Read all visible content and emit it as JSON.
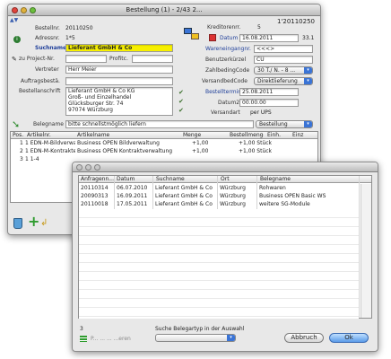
{
  "main": {
    "title": "Bestellung (1) - 2/43 2...",
    "order_id_right": "1'20110250",
    "bestellnr_label": "Bestellnr.",
    "bestellnr_value": "20110250",
    "adressnr_label": "Adressnr.",
    "adressnr_value": "1*5",
    "suchname_label": "Suchname",
    "suchname_value": "Lieferant GmbH & Co",
    "projekt_label": "zu Project-Nr.",
    "projekt_suffix": "Profitc.",
    "vertreter_label": "Vertreter",
    "vertreter_value": "Herr Meier",
    "auftragsbestae_label": "Auftragsbestä.",
    "bestellanschrift_label": "Bestellanschrift",
    "address_lines": [
      "Lieferant GmbH & Co KG",
      "Groß- und Einzelhandel",
      "Glücksburger Str. 74",
      "97074 Würzburg"
    ],
    "kreditorennr_label": "Kreditorenrr.",
    "kreditorennr_value": "5",
    "datum_label": "Datum",
    "datum_value": "16.08.2011",
    "kw_value": "33.1",
    "wareneingang_label": "Wareneingangnr.",
    "wareneingang_value": "<<<>",
    "benutzerkurzel_label": "Benutzerkürzel",
    "benutzerkurzel_value": "CU",
    "zahlbedingcode_label": "ZahlbedingCode",
    "zahlbedingcode_value": "30 T./ N. - 8 ...",
    "versandbedcode_label": "VersandbedCode",
    "versandbedcode_value": "Direktlieferung",
    "bestelltermin_label": "Bestelltermin",
    "bestelltermin_value": "25.08.2011",
    "datum2_label": "Datum2",
    "datum2_value": "00.00.00",
    "versandart_label": "Versandart",
    "versandart_value": "per UPS",
    "belegname_label": "Belegname",
    "belegname_value": "bitte schnellstmöglich liefern",
    "bestellung_select": "Bestellung",
    "table_headers": [
      "Pos.",
      "Artikelnr.",
      "Artikelname",
      "Menge",
      "Bestellmenge",
      "Einh.",
      "Einz"
    ],
    "table_rows": [
      [
        "1",
        "1 EDN-M-Bildverwaltung",
        "Business OPEN Bildverwaltung",
        "+1,00",
        "+1,00 Stück",
        ""
      ],
      [
        "2",
        "1 EDN-M-Kontrakte",
        "Business OPEN Kontraktverwaltung",
        "+1,00",
        "+1,00 Stück",
        ""
      ],
      [
        "3",
        "1 1-4",
        "",
        "",
        "",
        ""
      ]
    ]
  },
  "dialog": {
    "table_headers": [
      "Anfragenn...",
      "Datum",
      "Suchname",
      "Ort",
      "Belegname"
    ],
    "table_rows": [
      [
        "20110314",
        "06.07.2010",
        "Lieferant GmbH & Co",
        "Würzburg",
        "Rohwaren"
      ],
      [
        "20090313",
        "16.09.2011",
        "Lieferant GmbH & Co",
        "Würzburg",
        "Business OPEN Basic WS"
      ],
      [
        "20110018",
        "17.05.2011",
        "Lieferant GmbH & Co",
        "Würzburg",
        "weitere SG-Module"
      ]
    ],
    "count": "3",
    "search_label": "Suche Belegartyp in der Auswahl",
    "zoom_hint": "P... ... ... ...eren",
    "cancel_label": "Abbruch",
    "ok_label": "Ok"
  },
  "colors": {
    "selection_yellow": "#f7f000",
    "accent_blue": "#3a74d6",
    "link_blue": "#1f3f9a"
  }
}
